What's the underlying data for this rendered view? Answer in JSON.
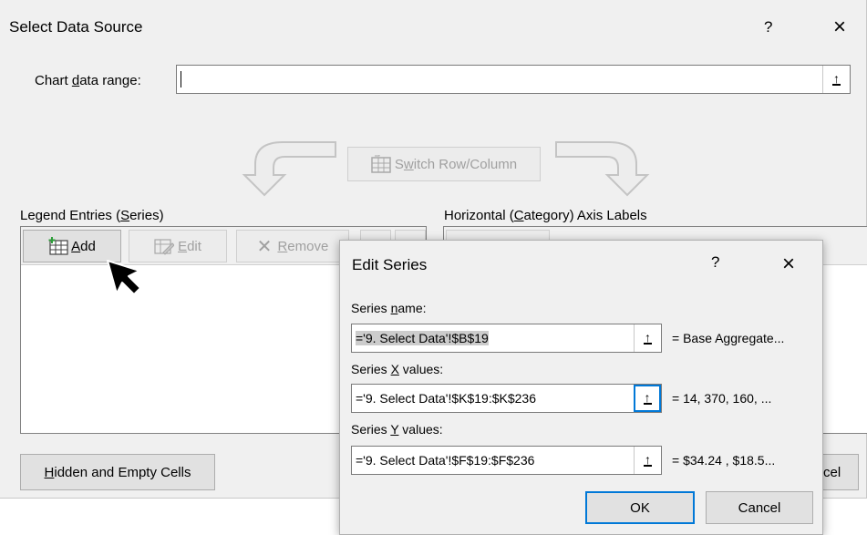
{
  "main_dialog": {
    "title": "Select Data Source",
    "help": "?",
    "close": "×",
    "chart_range": {
      "label_pre": "Chart ",
      "label_u": "d",
      "label_post": "ata range:",
      "value": ""
    },
    "switch": {
      "pre": "S",
      "u": "w",
      "post": "itch Row/Column"
    },
    "legend": {
      "label_pre": "Legend Entries (",
      "label_u": "S",
      "label_post": "eries)",
      "add": {
        "u": "A",
        "post": "dd"
      },
      "edit": {
        "u": "E",
        "post": "dit"
      },
      "remove": {
        "u": "R",
        "post": "emove"
      }
    },
    "axis": {
      "label_pre": "Horizontal (",
      "label_u": "C",
      "label_post": "ategory) Axis Labels"
    },
    "hidden": {
      "u": "H",
      "post": "idden and Empty Cells"
    },
    "cancel_partial": "cel"
  },
  "edit_series": {
    "title": "Edit Series",
    "help": "?",
    "close": "×",
    "name": {
      "label_pre": "Series ",
      "label_u": "n",
      "label_post": "ame:",
      "value": "='9. Select Data'!$B$19",
      "result": "= Base Aggregate..."
    },
    "x": {
      "label_pre": "Series ",
      "label_u": "X",
      "label_post": " values:",
      "value": "='9. Select Data'!$K$19:$K$236",
      "result": "= 14, 370, 160, ..."
    },
    "y": {
      "label_pre": "Series ",
      "label_u": "Y",
      "label_post": " values:",
      "value": "='9. Select Data'!$F$19:$F$236",
      "result": "= $34.24 , $18.5..."
    },
    "ok": "OK",
    "cancel": "Cancel"
  }
}
